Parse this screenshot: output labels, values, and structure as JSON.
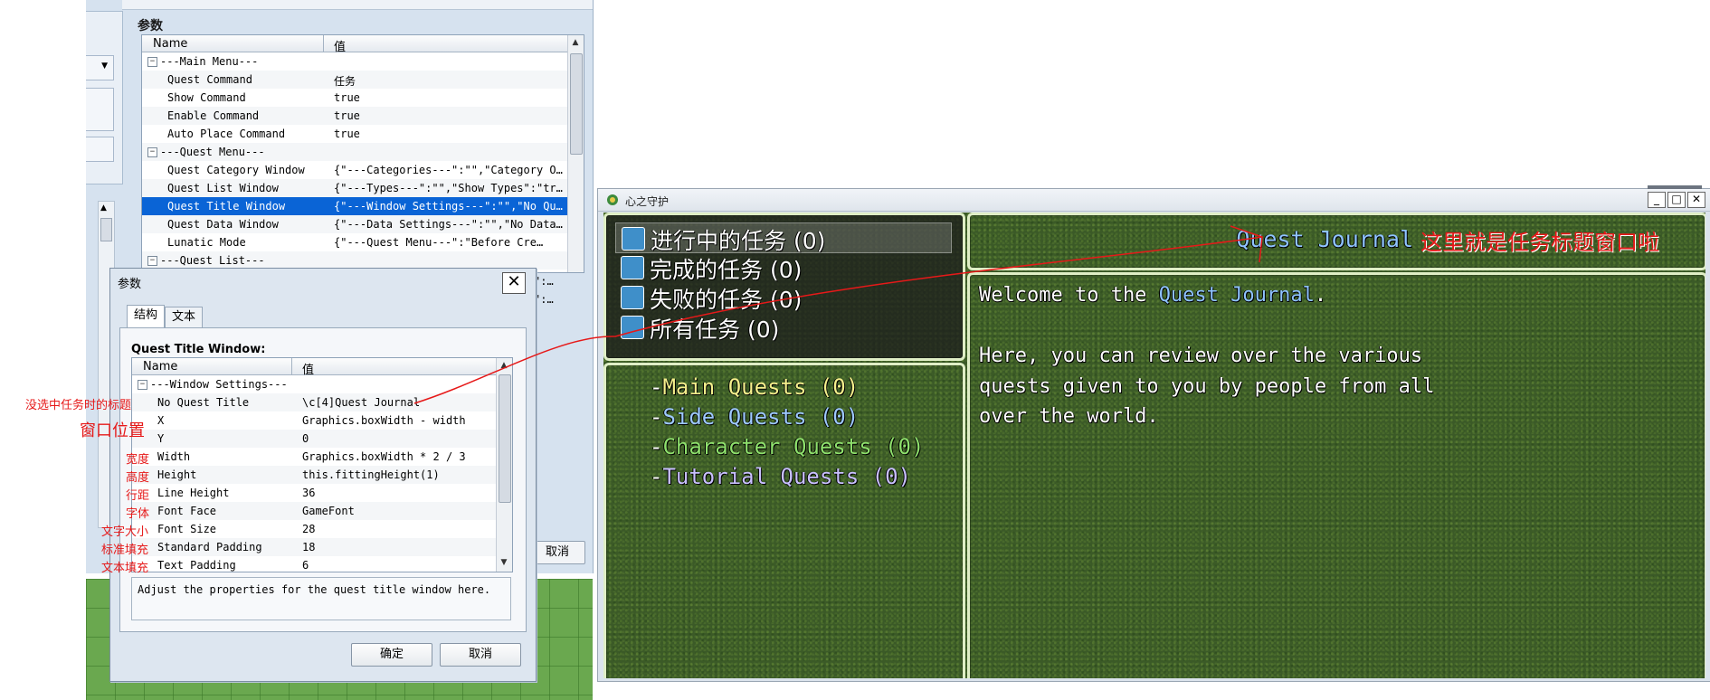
{
  "editor": {
    "params_group_label": "参数",
    "params_grid": {
      "headers": [
        "Name",
        "值"
      ],
      "rows": [
        {
          "key": "---Main Menu---",
          "value": "",
          "group": true
        },
        {
          "key": "Quest Command",
          "value": "任务"
        },
        {
          "key": "Show Command",
          "value": "true"
        },
        {
          "key": "Enable Command",
          "value": "true"
        },
        {
          "key": "Auto Place Command",
          "value": "true"
        },
        {
          "key": "---Quest Menu---",
          "value": "",
          "group": true
        },
        {
          "key": "Quest Category Window",
          "value": "{\"---Categories---\":\"\",\"Category O…"
        },
        {
          "key": "Quest List Window",
          "value": "{\"---Types---\":\"\",\"Show Types\":\"tr…"
        },
        {
          "key": "Quest Title Window",
          "value": "{\"---Window Settings---\":\"\",\"No Qu…",
          "selected": true
        },
        {
          "key": "Quest Data Window",
          "value": "{\"---Data Settings---\":\"\",\"No Data…"
        },
        {
          "key": "Lunatic Mode",
          "value": "{\"---Quest Menu---\":\"Before Cre…"
        },
        {
          "key": "---Quest List---",
          "value": "",
          "group": true
        }
      ]
    },
    "behind_fragments": [
      "\":…",
      "\":…"
    ],
    "cancel_label": "取消",
    "cancel_label_partial": "取消"
  },
  "dialog": {
    "title": "参数",
    "close_glyph": "✕",
    "tabs": [
      "结构",
      "文本"
    ],
    "section_label": "Quest Title Window:",
    "grid_headers": [
      "Name",
      "值"
    ],
    "rows": [
      {
        "key": "---Window Settings---",
        "value": "",
        "group": true
      },
      {
        "key": "No Quest Title",
        "value": "\\c[4]Quest Journal"
      },
      {
        "key": "X",
        "value": "Graphics.boxWidth - width"
      },
      {
        "key": "Y",
        "value": "0"
      },
      {
        "key": "Width",
        "value": "Graphics.boxWidth * 2 / 3"
      },
      {
        "key": "Height",
        "value": "this.fittingHeight(1)"
      },
      {
        "key": "Line Height",
        "value": "36"
      },
      {
        "key": "Font Face",
        "value": "GameFont"
      },
      {
        "key": "Font Size",
        "value": "28"
      },
      {
        "key": "Standard Padding",
        "value": "18"
      },
      {
        "key": "Text Padding",
        "value": "6"
      }
    ],
    "description": "Adjust the properties for the quest title window here.",
    "ok_label": "确定",
    "cancel_label": "取消"
  },
  "annotations": {
    "no_selection_title": "没选中任务时的标题",
    "window_position": "窗口位置",
    "width": "宽度",
    "height": "高度",
    "line_height": "行距",
    "font_face": "字体",
    "font_size": "文字大小",
    "standard_padding": "标准填充",
    "text_padding": "文本填充",
    "quest_title_window_note": "这里就是任务标题窗口啦",
    "color": "#e61919"
  },
  "game": {
    "window_title": "心之守护",
    "min_glyph": "_",
    "max_glyph": "□",
    "close_glyph": "✕",
    "categories": [
      {
        "label": "进行中的任务 (0)",
        "selected": true
      },
      {
        "label": "完成的任务 (0)"
      },
      {
        "label": "失败的任务 (0)"
      },
      {
        "label": "所有任务 (0)"
      }
    ],
    "quest_types": [
      {
        "dash": "-",
        "label": "Main Quests (0)",
        "color": "#f5f08c"
      },
      {
        "dash": "-",
        "label": "Side Quests (0)",
        "color": "#9ec9ff"
      },
      {
        "dash": "-",
        "label": "Character Quests (0)",
        "color": "#8ee06c"
      },
      {
        "dash": "-",
        "label": "Tutorial Quests (0)",
        "color": "#c9c0ff"
      }
    ],
    "title_window_text": "Quest Journal",
    "title_color": "#8fc3ff",
    "data_text": {
      "line1_prefix": "Welcome to the ",
      "line1_highlight": "Quest Journal",
      "line1_suffix": ".",
      "line2": "Here, you can review over the various",
      "line3": "quests given to you by people from all",
      "line4": "over the world."
    }
  }
}
